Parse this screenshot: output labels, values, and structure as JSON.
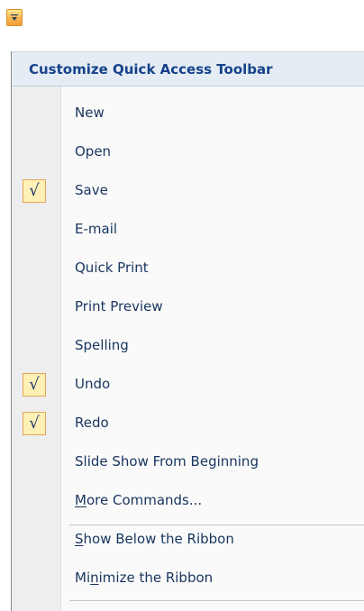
{
  "toolbar": {
    "dropdown_icon": "customize-quick-access-dropdown-icon"
  },
  "menu": {
    "title": "Customize Quick Access Toolbar",
    "check_icon": "√",
    "items": [
      {
        "label": "New",
        "checked": false
      },
      {
        "label": "Open",
        "checked": false
      },
      {
        "label": "Save",
        "checked": true
      },
      {
        "label": "E-mail",
        "checked": false
      },
      {
        "label": "Quick Print",
        "checked": false
      },
      {
        "label": "Print Preview",
        "checked": false
      },
      {
        "label": "Spelling",
        "checked": false
      },
      {
        "label": "Undo",
        "checked": true
      },
      {
        "label": "Redo",
        "checked": true
      },
      {
        "label": "Slide Show From Beginning",
        "checked": false
      }
    ],
    "more_commands": {
      "accelerator": "M",
      "rest": "ore Commands..."
    },
    "show_below": {
      "accelerator": "S",
      "rest": "how Below the Ribbon"
    },
    "minimize": {
      "before": "Mi",
      "accelerator": "n",
      "after": "imize the Ribbon"
    }
  },
  "colors": {
    "button_highlight": "#f8b54f",
    "menu_background": "#fafafa",
    "header_background": "#e5ecf4",
    "text": "#18355e",
    "check_background": "#fff0b6"
  }
}
